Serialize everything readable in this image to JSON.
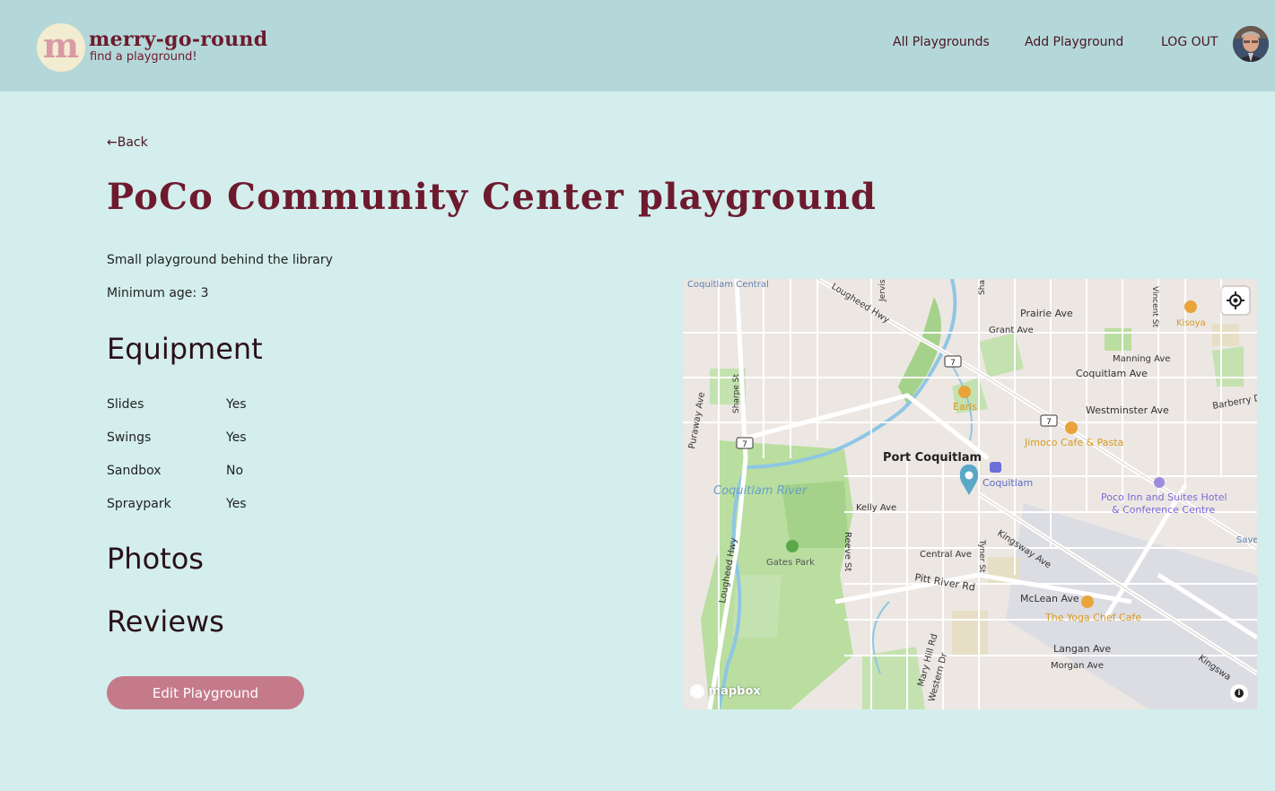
{
  "header": {
    "logo_letter": "m",
    "logo_title": "merry-go-round",
    "logo_subtitle": "find a playground!",
    "nav": {
      "all_playgrounds": "All Playgrounds",
      "add_playground": "Add Playground",
      "logout": "LOG OUT"
    }
  },
  "main": {
    "back_label": "←Back",
    "title": "PoCo Community Center playground",
    "description": "Small playground behind the library",
    "min_age_label": "Minimum age: 3",
    "equipment_heading": "Equipment",
    "equipment": [
      {
        "name": "Slides",
        "value": "Yes"
      },
      {
        "name": "Swings",
        "value": "Yes"
      },
      {
        "name": "Sandbox",
        "value": "No"
      },
      {
        "name": "Spraypark",
        "value": "Yes"
      }
    ],
    "photos_heading": "Photos",
    "reviews_heading": "Reviews",
    "edit_button": "Edit Playground"
  },
  "map": {
    "attribution_logo": "mapbox",
    "labels": {
      "coquitlam_central": "Coquitlam Central",
      "lougheed_hwy": "Lougheed Hwy",
      "jervis": "Jervis",
      "shaughnessy": "Sha",
      "prairie_ave": "Prairie Ave",
      "grant_ave": "Grant Ave",
      "vincent_st": "Vincent St",
      "kisoya": "Kisoya",
      "manning_ave": "Manning Ave",
      "coquitlam_ave": "Coquitlam Ave",
      "barberry": "Barberry D",
      "earls": "Earls",
      "westminster_ave": "Westminster Ave",
      "jimoco": "Jimoco Cafe & Pasta",
      "puraway": "Puraway Ave",
      "sharpe_st": "Sharpe St",
      "port_coquitlam": "Port Coquitlam",
      "coquitlam": "Coquitlam",
      "poco_inn_1": "Poco Inn and Suites Hotel",
      "poco_inn_2": "& Conference Centre",
      "coquitlam_river": "Coquitlam River",
      "kelly_ave": "Kelly Ave",
      "kingsway_ave": "Kingsway Ave",
      "save": "Save",
      "gates_park": "Gates Park",
      "reeve_st": "Reeve St",
      "central_ave": "Central Ave",
      "tyner_st": "Tyner St",
      "pitt_river_rd": "Pitt River Rd",
      "lougheed_hwy_2": "Lougheed Hwy",
      "mclean_ave": "McLean Ave",
      "yoga_chef": "The Yoga Chef Cafe",
      "langan_ave": "Langan Ave",
      "morgan_ave": "Morgan Ave",
      "mary_hill_rd": "Mary Hill Rd",
      "western_dr": "Western Dr",
      "kingsway_2": "Kingswa",
      "route_7": "7"
    }
  },
  "colors": {
    "page_bg": "#d3eeec",
    "header_bg": "#b4d8d9",
    "brand": "#6e1a2e",
    "button": "#c57a8a",
    "map_pin": "#5aa7c7"
  }
}
